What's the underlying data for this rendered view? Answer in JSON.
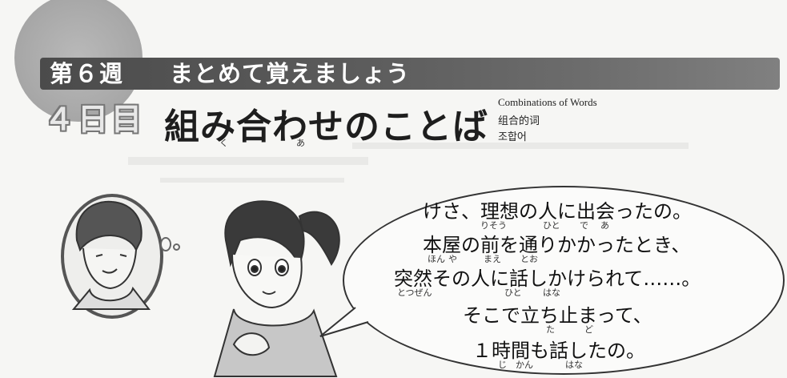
{
  "header": {
    "week_label": "第６週",
    "week_title": "まとめて覚えましょう",
    "day_label": "４日目",
    "title": "組み合わせのことば",
    "title_ruby": [
      "く",
      "あ"
    ],
    "subtitles": [
      "Combinations of Words",
      "组合的词",
      "조합어"
    ]
  },
  "speech": {
    "lines": [
      {
        "text": "けさ、理想の人に出会ったの。",
        "ruby": [
          "りそう",
          "ひと",
          "で",
          "あ"
        ]
      },
      {
        "text": "本屋の前を通りかかったとき、",
        "ruby": [
          "ほん",
          "や",
          "まえ",
          "とお"
        ]
      },
      {
        "text": "突然その人に話しかけられて……。",
        "ruby": [
          "とつぜん",
          "ひと",
          "はな"
        ]
      },
      {
        "text": "そこで立ち止まって、",
        "ruby": [
          "た",
          "ど"
        ]
      },
      {
        "text": "１時間も話したの。",
        "ruby": [
          "じ",
          "かん",
          "はな"
        ]
      }
    ]
  },
  "colors": {
    "banner": "#5a5a5a",
    "badge_circle": "#a9a9a9",
    "text": "#1a1a1a"
  }
}
